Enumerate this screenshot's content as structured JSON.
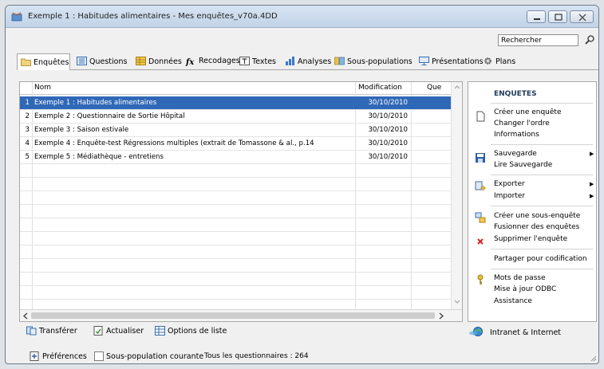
{
  "window": {
    "title": "Exemple 1 : Habitudes alimentaires - Mes enquêtes_v70a.4DD"
  },
  "search": {
    "value": "Rechercher"
  },
  "tabs": [
    {
      "label": "Enquêtes",
      "icon": "folder-icon"
    },
    {
      "label": "Questions",
      "icon": "list-icon"
    },
    {
      "label": "Données",
      "icon": "table-icon"
    },
    {
      "label": "Recodages",
      "icon": "function-icon"
    },
    {
      "label": "Textes",
      "icon": "text-icon"
    },
    {
      "label": "Analyses",
      "icon": "bar-chart-icon"
    },
    {
      "label": "Sous-populations",
      "icon": "filter-icon"
    },
    {
      "label": "Présentations",
      "icon": "presentation-icon"
    },
    {
      "label": "Plans",
      "icon": "gear-icon"
    }
  ],
  "grid": {
    "columns": [
      "Nom",
      "Modification",
      "Que"
    ],
    "rows": [
      {
        "num": "1",
        "name": "Exemple 1 : Habitudes alimentaires",
        "date": "30/10/2010"
      },
      {
        "num": "2",
        "name": "Exemple 2 : Questionnaire de Sortie  Hôpital",
        "date": "30/10/2010"
      },
      {
        "num": "3",
        "name": "Exemple 3 : Saison estivale",
        "date": "30/10/2010"
      },
      {
        "num": "4",
        "name": "Exemple 4 : Enquête-test Régressions multiples (extrait de Tomassone & al., p.14",
        "date": "30/10/2010"
      },
      {
        "num": "5",
        "name": "Exemple 5 : Médiathèque - entretiens",
        "date": "30/10/2010"
      }
    ]
  },
  "side": {
    "title": "ENQUETES",
    "items": [
      "Créer une enquête",
      "Changer l'ordre",
      "Informations",
      "Sauvegarde",
      "Lire Sauvegarde",
      "Exporter",
      "Importer",
      "Créer une sous-enquête",
      "Fusionner des enquêtes",
      "Supprimer l'enquête",
      "Partager pour codification",
      "Mots de passe",
      "Mise à jour ODBC",
      "Assistance"
    ],
    "intranet": "Intranet & Internet"
  },
  "bottom": {
    "transfer": "Transférer",
    "refresh": "Actualiser",
    "list_options": "Options de liste"
  },
  "footer": {
    "preferences": "Préférences",
    "subpop": "Sous-population courante",
    "all": "Tous les questionnaires : 264"
  }
}
